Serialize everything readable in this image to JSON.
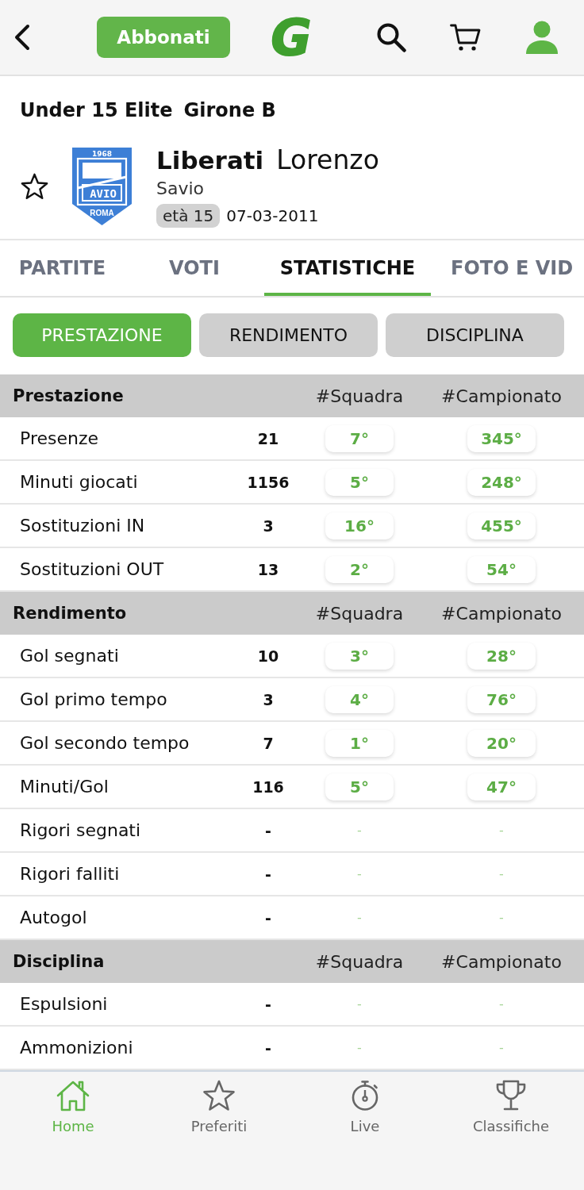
{
  "header": {
    "subscribe_button": "Abbonati",
    "logo": "G"
  },
  "competition": {
    "name": "Under 15 Elite",
    "group": "Girone B"
  },
  "player": {
    "surname": "Liberati",
    "first_name": "Lorenzo",
    "team": "Savio",
    "age": "età 15",
    "birth_date": "07-03-2011",
    "favorite": false,
    "crest": {
      "year": "1968",
      "name": "AVIO",
      "city": "ROMA"
    }
  },
  "tabs": [
    {
      "label": "PARTITE",
      "selected": false
    },
    {
      "label": "VOTI",
      "selected": false
    },
    {
      "label": "STATISTICHE",
      "selected": true
    },
    {
      "label": "FOTO E VID",
      "selected": false
    }
  ],
  "filters": [
    {
      "label": "PRESTAZIONE",
      "selected": true
    },
    {
      "label": "RENDIMENTO",
      "selected": false
    },
    {
      "label": "DISCIPLINA",
      "selected": false
    }
  ],
  "sections": [
    {
      "title": "Prestazione",
      "columns": [
        "#Squadra",
        "#Campionato"
      ],
      "rows": [
        {
          "kind": "ranked",
          "label": "Presenze",
          "value": "21",
          "team_rank": "7°",
          "league_rank": "345°"
        },
        {
          "kind": "ranked",
          "label": "Minuti giocati",
          "value": "1156",
          "team_rank": "5°",
          "league_rank": "248°"
        },
        {
          "kind": "ranked",
          "label": "Sostituzioni IN",
          "value": "3",
          "team_rank": "16°",
          "league_rank": "455°"
        },
        {
          "kind": "ranked",
          "label": "Sostituzioni OUT",
          "value": "13",
          "team_rank": "2°",
          "league_rank": "54°"
        }
      ]
    },
    {
      "title": "Rendimento",
      "columns": [
        "#Squadra",
        "#Campionato"
      ],
      "rows": [
        {
          "kind": "ranked",
          "label": "Gol segnati",
          "value": "10",
          "team_rank": "3°",
          "league_rank": "28°"
        },
        {
          "kind": "ranked",
          "label": "Gol primo tempo",
          "value": "3",
          "team_rank": "4°",
          "league_rank": "76°"
        },
        {
          "kind": "ranked",
          "label": "Gol secondo tempo",
          "value": "7",
          "team_rank": "1°",
          "league_rank": "20°"
        },
        {
          "kind": "ranked",
          "label": "Minuti/Gol",
          "value": "116",
          "team_rank": "5°",
          "league_rank": "47°"
        },
        {
          "kind": "empty",
          "label": "Rigori segnati",
          "value": "-",
          "team_rank": "-",
          "league_rank": "-"
        },
        {
          "kind": "empty",
          "label": "Rigori falliti",
          "value": "-",
          "team_rank": "-",
          "league_rank": "-"
        },
        {
          "kind": "empty",
          "label": "Autogol",
          "value": "-",
          "team_rank": "-",
          "league_rank": "-"
        }
      ]
    },
    {
      "title": "Disciplina",
      "columns": [
        "#Squadra",
        "#Campionato"
      ],
      "rows": [
        {
          "kind": "empty",
          "label": "Espulsioni",
          "value": "-",
          "team_rank": "-",
          "league_rank": "-"
        },
        {
          "kind": "empty",
          "label": "Ammonizioni",
          "value": "-",
          "team_rank": "-",
          "league_rank": "-"
        }
      ]
    }
  ],
  "bottom_nav": [
    {
      "label": "Home",
      "selected": true
    },
    {
      "label": "Preferiti",
      "selected": false
    },
    {
      "label": "Live",
      "selected": false
    },
    {
      "label": "Classifiche",
      "selected": false
    }
  ]
}
